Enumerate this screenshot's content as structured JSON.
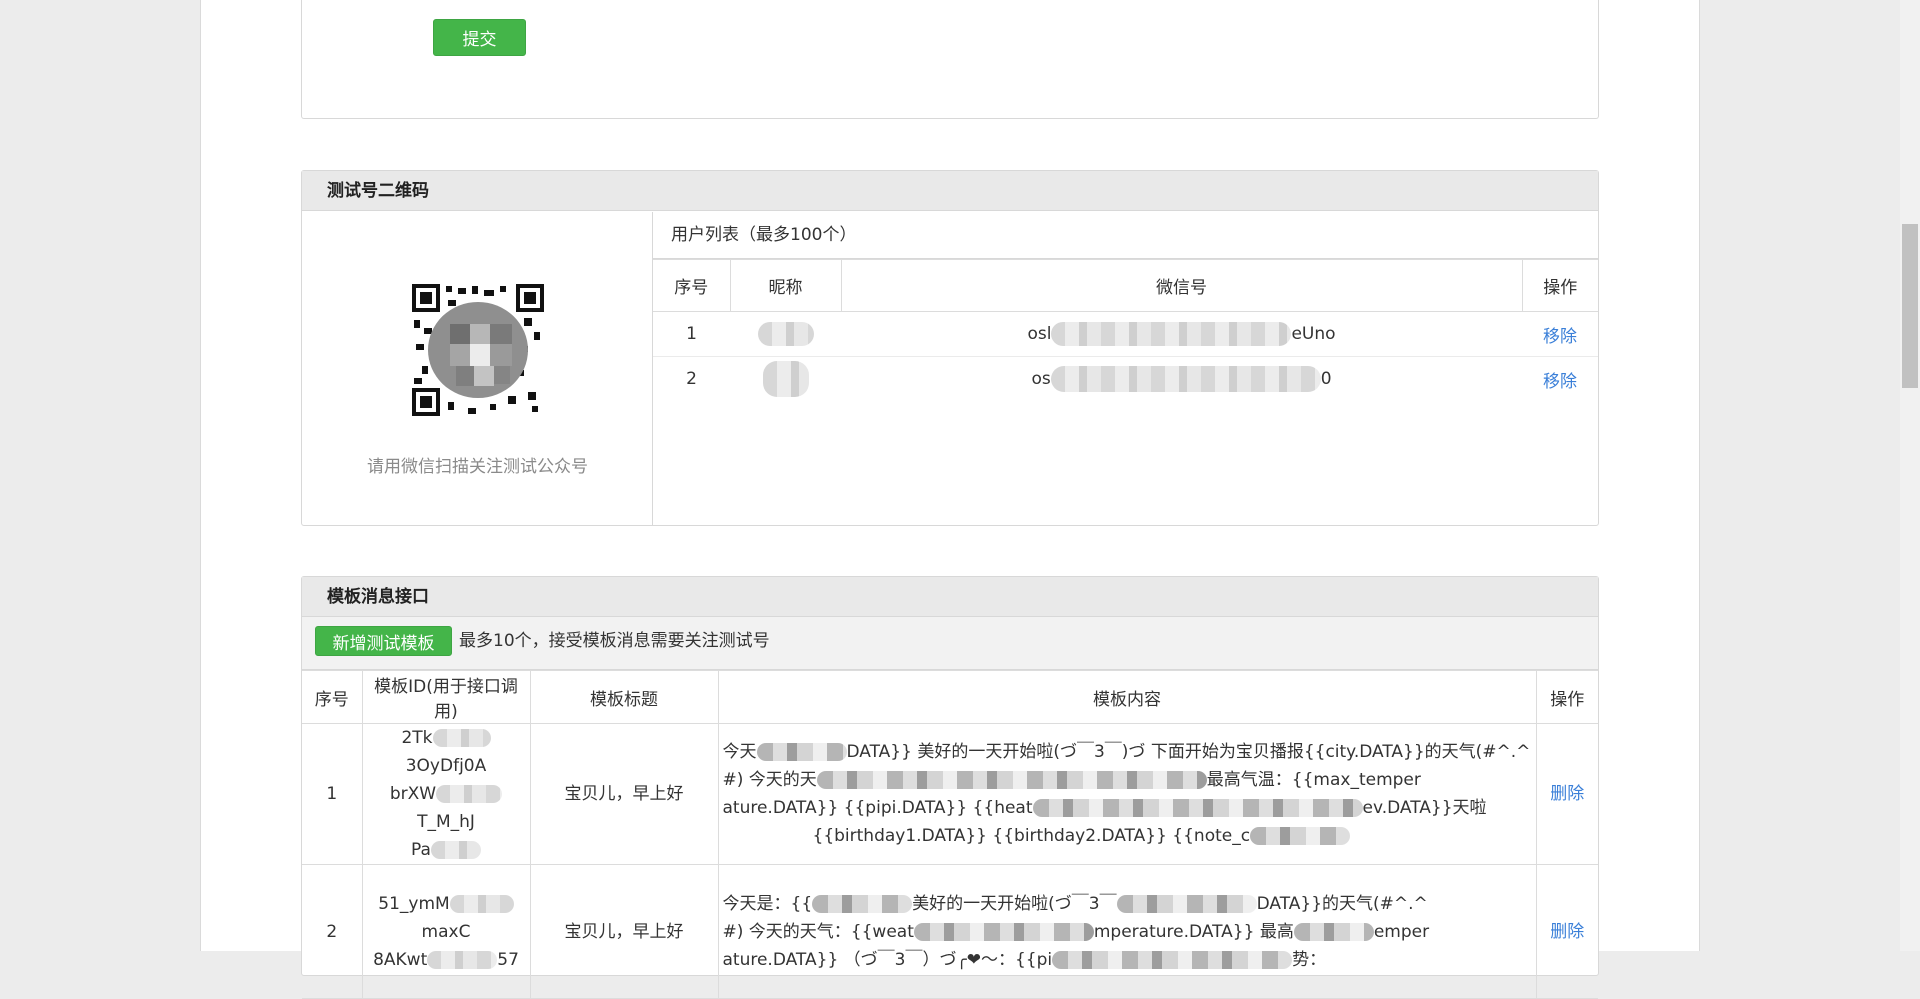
{
  "submit": {
    "button_label": "提交"
  },
  "qr_panel": {
    "title": "测试号二维码",
    "caption": "请用微信扫描关注测试公众号",
    "user_list_caption": "用户列表（最多100个）",
    "columns": [
      "序号",
      "昵称",
      "微信号",
      "操作"
    ],
    "rows": [
      {
        "index": "1",
        "id_start": "osl",
        "id_end": "eUno",
        "action": "移除"
      },
      {
        "index": "2",
        "id_start": "os",
        "id_end": "0",
        "action": "移除"
      }
    ]
  },
  "template_panel": {
    "title": "模板消息接口",
    "add_button": "新增测试模板",
    "note": "最多10个，接受模板消息需要关注测试号",
    "columns": [
      "序号",
      "模板ID(用于接口调用)",
      "模板标题",
      "模板内容",
      "操作"
    ],
    "rows": [
      {
        "index": "1",
        "id_lines": [
          "2Tk",
          "3OyDfj0A",
          "brXW",
          "T_M_hJ",
          "Pa"
        ],
        "title": "宝贝儿，早上好",
        "content_lines": [
          "今天",
          "DATA}} 美好的一天开始啦(づ￣3￣)づ 下面开始为宝贝播报{{city.DATA}}的天气(#^.^",
          "#) 今天的天",
          "最高气温：{{max_temper",
          "ature.DATA}} {{pipi.DATA}} {{heat",
          "ev.DATA}}天啦",
          "{{birthday1.DATA}} {{birthday2.DATA}} {{note_c"
        ],
        "action": "删除"
      },
      {
        "index": "2",
        "id_lines": [
          "51_ymM",
          "maxC",
          "8AKwt",
          "57"
        ],
        "title": "宝贝儿，早上好",
        "content_lines": [
          "今天是：{{",
          "美好的一天开始啦(づ￣3￣",
          "DATA}}的天气(#^.^",
          "#) 今天的天气：{{weat",
          "mperature.DATA}} 最高",
          "emper",
          "ature.DATA}} （づ￣3￣）づ╭❤～：{{pi",
          "势："
        ],
        "action": "删除"
      }
    ]
  }
}
